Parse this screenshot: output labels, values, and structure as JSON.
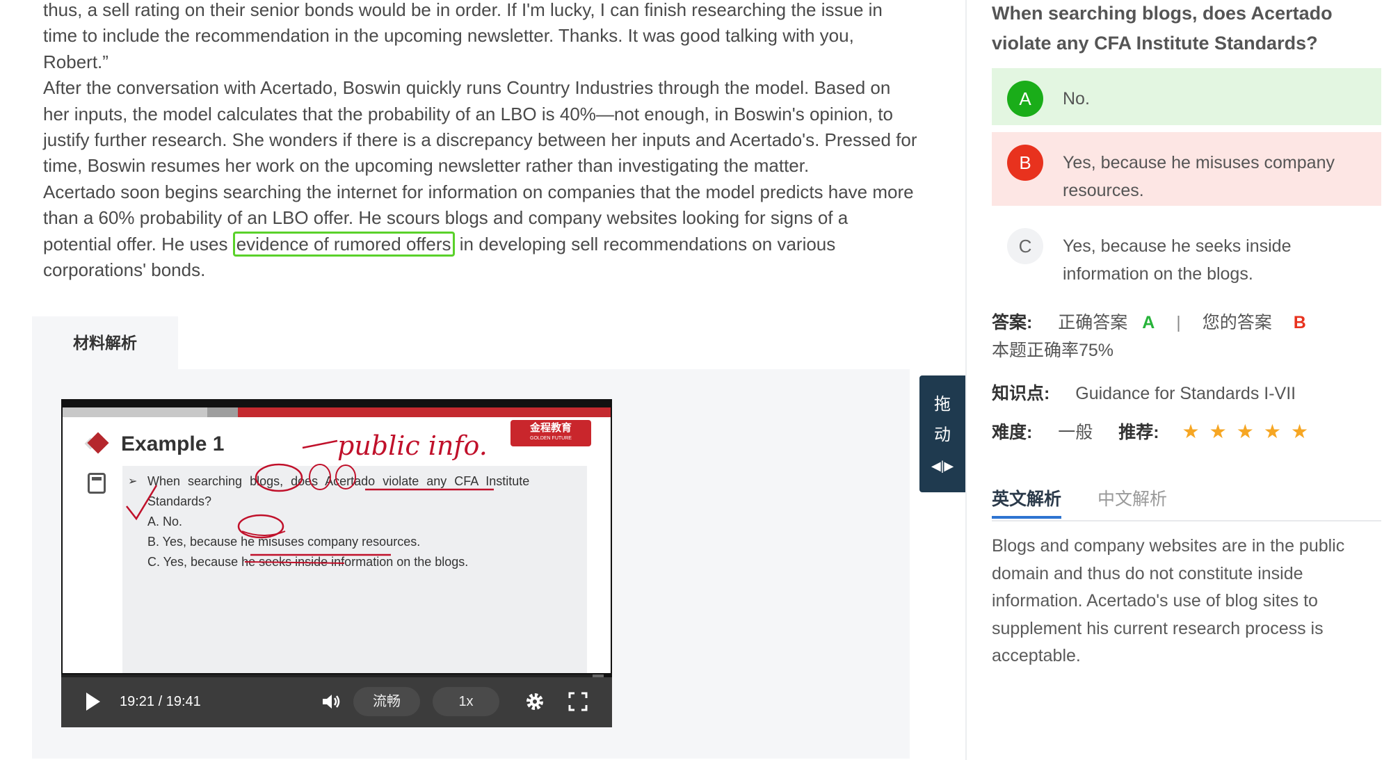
{
  "passage": {
    "p1": "thus, a sell rating on their senior bonds would be in order. If I'm lucky, I can finish researching the issue in time to include the recommendation in the upcoming newsletter. Thanks. It was good talking with you, Robert.”",
    "p2": "After the conversation with Acertado, Boswin quickly runs Country Industries through the model. Based on her inputs, the model calculates that the probability of an LBO is 40%—not enough, in Boswin's opinion, to justify further research. She wonders if there is a discrepancy between her inputs and Acertado's. Pressed for time, Boswin resumes her work on the upcoming newsletter rather than investigating the matter.",
    "p3_before": "Acertado soon begins searching the internet for information on companies that the model predicts have more than a 60% probability of an LBO offer. He scours blogs and company websites looking for signs of a potential offer. He uses ",
    "p3_highlight": "evidence of rumored offers",
    "p3_after": " in developing sell recommendations on various corporations' bonds."
  },
  "material_tab": "材料解析",
  "video": {
    "slide_title": "Example 1",
    "brand_name": "金程教育",
    "brand_sub": "GOLDEN FUTURE",
    "question": "When searching blogs, does Acertado violate any CFA Institute Standards?",
    "options": [
      "A.  No.",
      "B.  Yes, because he misuses company resources.",
      "C.  Yes, because he seeks inside information on the blogs."
    ],
    "annotation": "public info.",
    "time": "19:21 / 19:41",
    "progress": 0.98,
    "quality_label": "流畅",
    "speed_label": "1x"
  },
  "drag_handle": {
    "char1": "拖",
    "char2": "动"
  },
  "question": {
    "title": "When searching blogs, does Acertado violate any CFA Institute Standards?",
    "options": [
      {
        "letter": "A",
        "text": "No.",
        "color": "#1aad19"
      },
      {
        "letter": "B",
        "text": "Yes, because he misuses company resources.",
        "color": "#e8321e"
      },
      {
        "letter": "C",
        "text": "Yes, because he seeks inside information on the blogs.",
        "color": "#f1f2f4"
      }
    ]
  },
  "answer": {
    "label": "答案:",
    "correct_label": "正确答案",
    "correct": "A",
    "sep": "|",
    "yours_label": "您的答案",
    "yours": "B",
    "rate": "本题正确率75%"
  },
  "knowledge": {
    "label": "知识点:",
    "value": "Guidance for Standards I-VII"
  },
  "difficulty": {
    "label": "难度:",
    "value": "一般",
    "rec_label": "推荐:",
    "stars": 5
  },
  "explain_tabs": {
    "en": "英文解析",
    "cn": "中文解析"
  },
  "explanation": "Blogs and company websites are in the public domain and thus do not constitute inside information. Acertado's use of blog sites to supplement his current research process is acceptable."
}
